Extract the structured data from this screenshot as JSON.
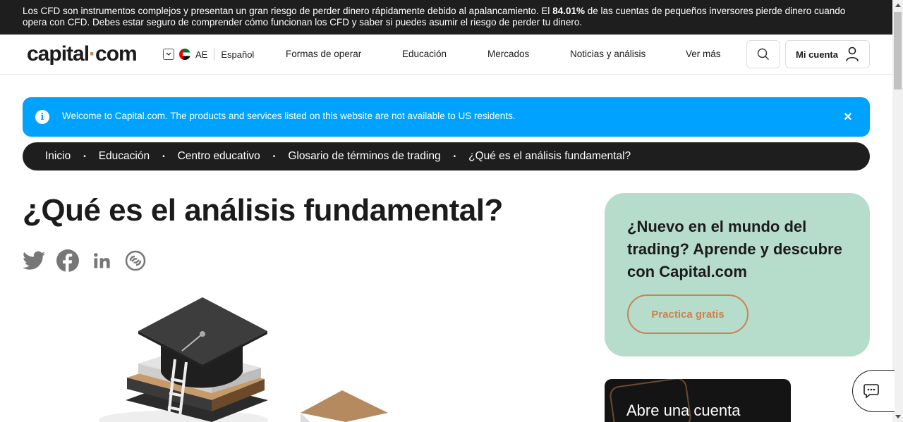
{
  "risk_warning": {
    "text_before": "Los CFD son instrumentos complejos y presentan un gran riesgo de perder dinero rápidamente debido al apalancamiento. El ",
    "percent": "84.01%",
    "text_after": " de las cuentas de pequeños inversores pierde dinero cuando opera con CFD. Debes estar seguro de comprender cómo funcionan los CFD y saber si puedes asumir el riesgo de perder tu dinero."
  },
  "header": {
    "logo_left": "capital",
    "logo_dot": "·",
    "logo_right": "com",
    "region_code": "AE",
    "language": "Español",
    "nav": [
      "Formas de operar",
      "Educación",
      "Mercados",
      "Noticias y análisis",
      "Ver más"
    ],
    "account_label": "Mi cuenta"
  },
  "welcome_banner": {
    "message": "Welcome to Capital.com. The products and services listed on this website are not available to US residents.",
    "close": "×",
    "info": "i"
  },
  "breadcrumb": [
    "Inicio",
    "Educación",
    "Centro educativo",
    "Glosario de términos de trading",
    "¿Qué es el análisis fundamental?"
  ],
  "breadcrumb_separator": "•",
  "article": {
    "title": "¿Qué es el análisis fundamental?"
  },
  "social_icons": [
    "twitter-icon",
    "facebook-icon",
    "linkedin-icon",
    "link-icon"
  ],
  "promo": {
    "heading": "¿Nuevo en el mundo del trading? Aprende y descubre con Capital.com",
    "button": "Practica gratis",
    "background": "#b6dccc",
    "accent": "#c9834f"
  },
  "promo2": {
    "heading": "Abre una cuenta"
  },
  "colors": {
    "banner_blue": "#00a2ff",
    "dark": "#1e1e1e"
  }
}
